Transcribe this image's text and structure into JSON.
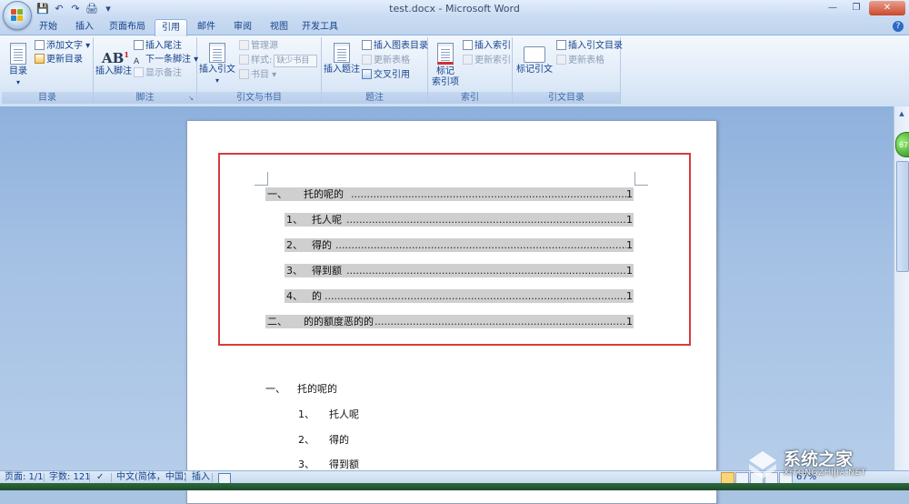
{
  "window": {
    "title": "test.docx - Microsoft Word",
    "controls": {
      "minimize": "—",
      "maximize": "❐",
      "close": "✕"
    }
  },
  "qat": {
    "save": "💾",
    "undo": "↶",
    "redo": "↷",
    "print": "🖨",
    "more": "▾"
  },
  "tabs": [
    "开始",
    "插入",
    "页面布局",
    "引用",
    "邮件",
    "审阅",
    "视图",
    "开发工具"
  ],
  "active_tab": "引用",
  "ribbon": {
    "toc": {
      "label": "目录",
      "big": "目录",
      "add_text": "添加文字 ▾",
      "update_toc": "更新目录"
    },
    "footnotes": {
      "label": "脚注",
      "big": "插入脚注",
      "insert_endnote": "插入尾注",
      "next_footnote": "下一条脚注 ▾",
      "show_notes": "显示备注"
    },
    "citations": {
      "label": "引文与书目",
      "big": "插入引文",
      "manage_sources": "管理源",
      "style": "样式:",
      "style_value": "缺少书目",
      "bibliography": "书目 ▾"
    },
    "captions": {
      "label": "题注",
      "big": "插入题注",
      "insert_table_of_figures": "插入图表目录",
      "update_table": "更新表格",
      "cross_reference": "交叉引用"
    },
    "index": {
      "label": "索引",
      "big": "标记\n索引项",
      "big_line1": "标记",
      "big_line2": "索引项",
      "insert_index": "插入索引",
      "update_index": "更新索引"
    },
    "toa": {
      "label": "引文目录",
      "big": "标记引文",
      "insert_toa": "插入引文目录",
      "update_table": "更新表格"
    }
  },
  "document": {
    "toc": [
      {
        "num": "一、",
        "text": "托的呢的",
        "page": "1",
        "level": 1
      },
      {
        "num": "1、",
        "text": "托人呢",
        "page": "1",
        "level": 2
      },
      {
        "num": "2、",
        "text": "得的",
        "page": "1",
        "level": 2
      },
      {
        "num": "3、",
        "text": "得到额",
        "page": "1",
        "level": 2
      },
      {
        "num": "4、",
        "text": "的",
        "page": "1",
        "level": 2
      },
      {
        "num": "二、",
        "text": "的的额度恶的的",
        "page": "1",
        "level": 1
      }
    ],
    "body": [
      {
        "num": "一、",
        "text": "托的呢的",
        "level": 1
      },
      {
        "num": "1、",
        "text": "托人呢",
        "level": 2
      },
      {
        "num": "2、",
        "text": "得的",
        "level": 2
      },
      {
        "num": "3、",
        "text": "得到额",
        "level": 2
      }
    ],
    "zoom_badge": "67"
  },
  "statusbar": {
    "page": "页面: 1/1",
    "words": "字数: 121",
    "language": "中文(简体，中国)",
    "mode": "插入",
    "zoom": "67%"
  },
  "watermark": {
    "main": "系统之家",
    "sub": "XITONGZHIJIA.NET"
  },
  "colors": {
    "highlight_frame": "#d93a3a",
    "ribbon_text": "#15428b",
    "toc_field_shading": "#cfcfcf"
  }
}
